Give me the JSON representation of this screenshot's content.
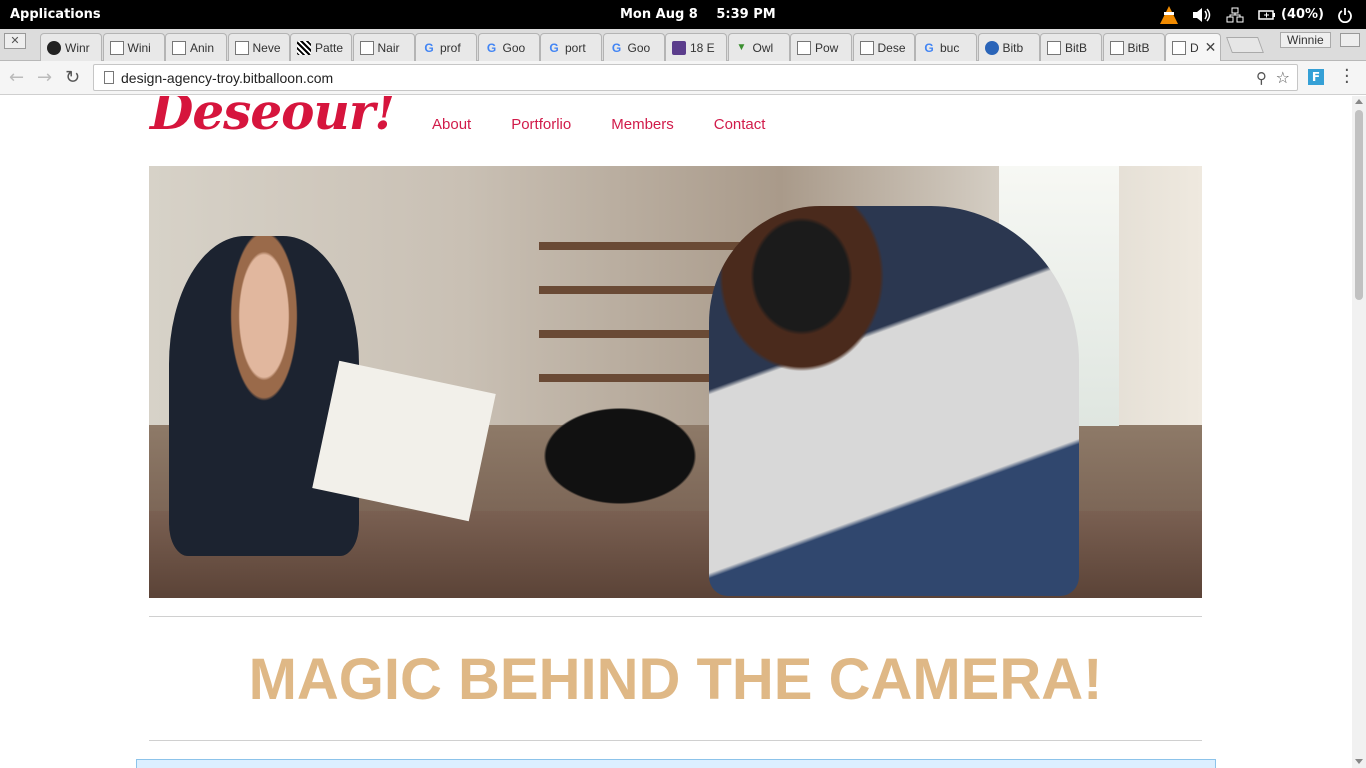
{
  "system": {
    "applications_label": "Applications",
    "date": "Mon Aug  8",
    "time": "5:39 PM",
    "battery": "(40%)",
    "icons": [
      "vlc-icon",
      "volume-icon",
      "network-icon",
      "battery-icon",
      "power-icon"
    ]
  },
  "browser": {
    "tabs": [
      {
        "title": "Winr",
        "icon": "github-icon"
      },
      {
        "title": "Wini",
        "icon": "page-icon"
      },
      {
        "title": "Anin",
        "icon": "page-icon"
      },
      {
        "title": "Neve",
        "icon": "page-icon"
      },
      {
        "title": "Patte",
        "icon": "pattern-icon"
      },
      {
        "title": "Nair",
        "icon": "page-icon"
      },
      {
        "title": "prof",
        "icon": "google-icon"
      },
      {
        "title": "Goo",
        "icon": "google-icon"
      },
      {
        "title": "port",
        "icon": "google-icon"
      },
      {
        "title": "Goo",
        "icon": "google-icon"
      },
      {
        "title": "18 E",
        "icon": "colorlib-icon"
      },
      {
        "title": "Owl",
        "icon": "owl-icon"
      },
      {
        "title": "Pow",
        "icon": "page-icon"
      },
      {
        "title": "Dese",
        "icon": "page-icon"
      },
      {
        "title": "buc",
        "icon": "google-icon"
      },
      {
        "title": "Bitb",
        "icon": "bitbucket-icon"
      },
      {
        "title": "BitB",
        "icon": "page-icon"
      },
      {
        "title": "BitB",
        "icon": "page-icon"
      },
      {
        "title": "D",
        "icon": "page-icon",
        "active": true
      }
    ],
    "profile_name": "Winnie",
    "url": "design-agency-troy.bitballoon.com",
    "extension_label": "F"
  },
  "site": {
    "logo": "Deseour!",
    "nav": [
      "About",
      "Portforlio",
      "Members",
      "Contact"
    ],
    "headline": "MAGIC BEHIND THE CAMERA!",
    "colors": {
      "brand": "#d6153d",
      "nav": "#d11b4a",
      "headline": "#dfb886"
    }
  }
}
